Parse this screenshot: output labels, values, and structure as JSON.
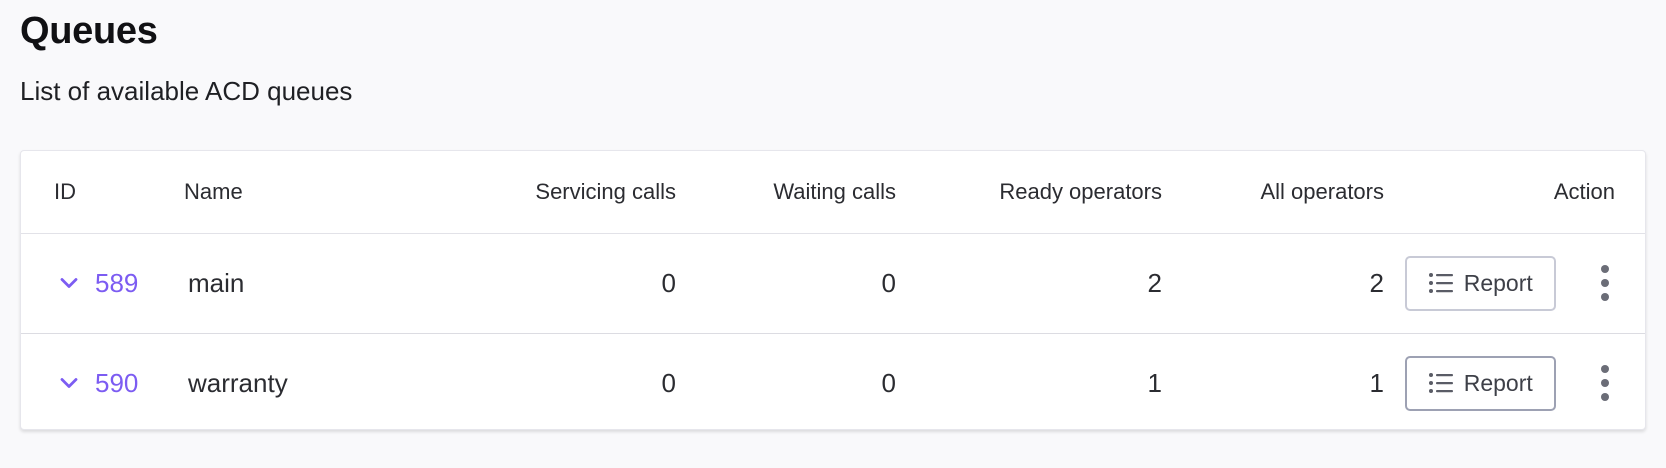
{
  "page": {
    "title": "Queues",
    "subtitle": "List of available ACD queues"
  },
  "table": {
    "headers": {
      "id": "ID",
      "name": "Name",
      "servicing_calls": "Servicing calls",
      "waiting_calls": "Waiting calls",
      "ready_operators": "Ready operators",
      "all_operators": "All operators",
      "action": "Action"
    },
    "rows": [
      {
        "id": "589",
        "name": "main",
        "servicing_calls": "0",
        "waiting_calls": "0",
        "ready_operators": "2",
        "all_operators": "2",
        "report_label": "Report"
      },
      {
        "id": "590",
        "name": "warranty",
        "servicing_calls": "0",
        "waiting_calls": "0",
        "ready_operators": "1",
        "all_operators": "1",
        "report_label": "Report"
      }
    ]
  },
  "icons": {
    "expand": "chevron-down-icon",
    "report": "list-icon",
    "more": "more-vertical-icon"
  },
  "colors": {
    "accent": "#7c5cf2",
    "background": "#f9f9fb",
    "card": "#ffffff",
    "button_border": "#c8cad6"
  }
}
